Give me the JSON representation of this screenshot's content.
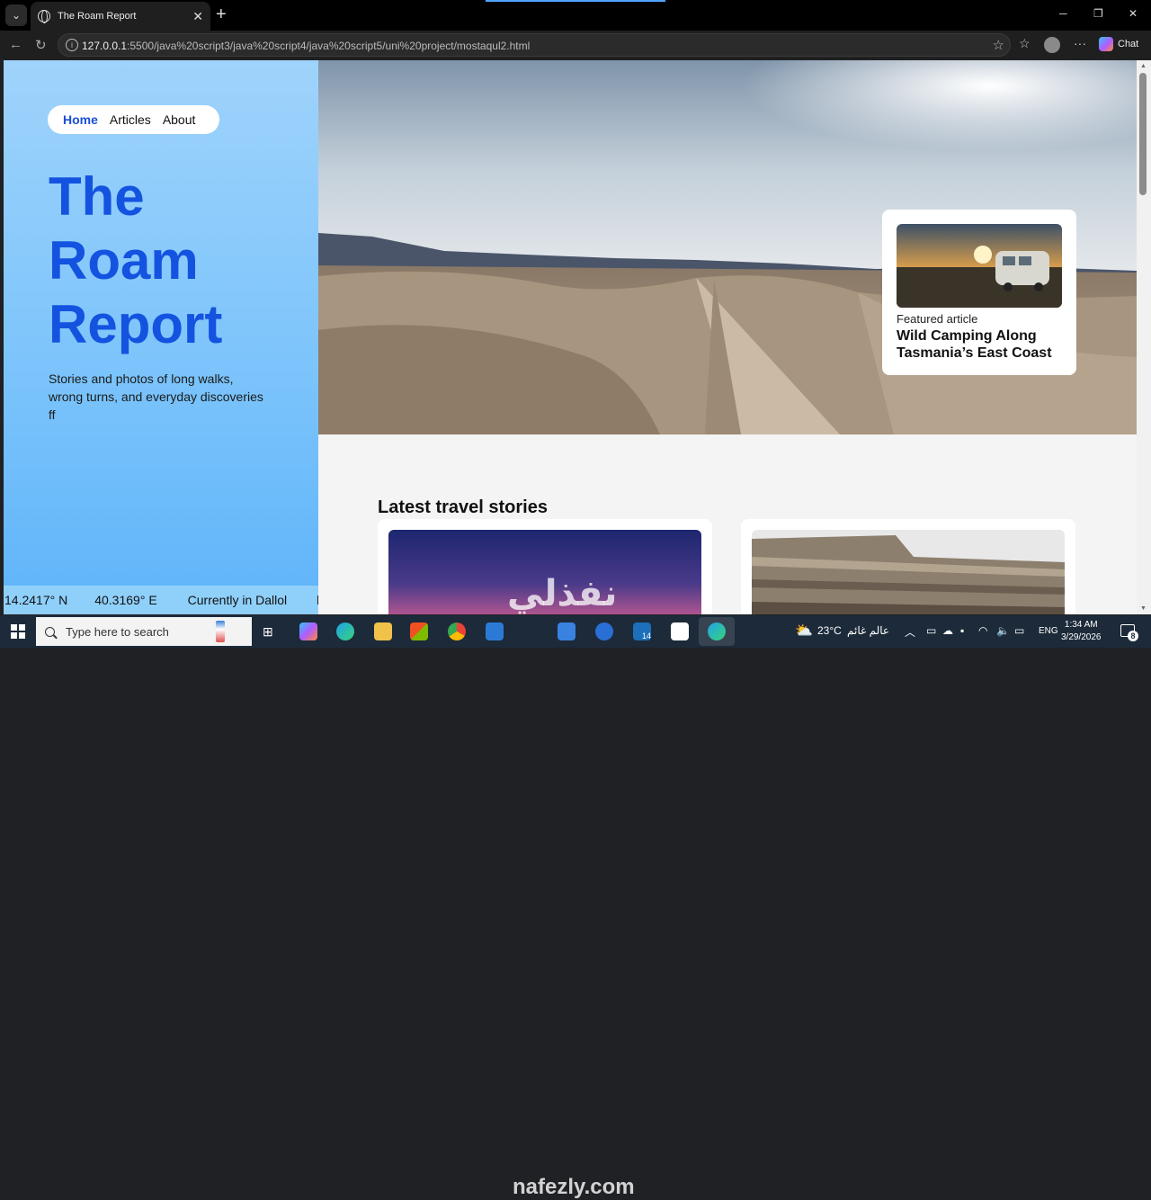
{
  "browser": {
    "tab_title": "The Roam Report",
    "new_tab": "+",
    "close_tab": "✕",
    "url_host": "127.0.0.1",
    "url_rest": ":5500/java%20script3/java%20script4/java%20script5/uni%20project/mostaqul2.html",
    "chat_label": "Chat"
  },
  "site": {
    "nav": {
      "home": "Home",
      "articles": "Articles",
      "about": "About"
    },
    "hero_title_line1": "The",
    "hero_title_line2": "Roam",
    "hero_title_line3": "Report",
    "hero_subtitle": "Stories and photos of long walks, wrong turns, and everyday discoveries ff",
    "ticker": {
      "latitude": "14.2417° N",
      "longitude": "40.3169° E",
      "location": "Currently in Dallol",
      "trailing": "l"
    },
    "featured": {
      "label": "Featured article",
      "title": "Wild Camping Along Tasmania’s East Coast"
    },
    "latest_heading": "Latest travel stories"
  },
  "watermark": {
    "arabic": "نفذلي",
    "latin": "nafezly.com"
  },
  "taskbar": {
    "search_placeholder": "Type here to search",
    "weather": "23°C",
    "weather_text": "عالم غائم",
    "language": "ENG",
    "time": "1:34 AM",
    "date": "3/29/2026",
    "badge_14": "14",
    "notif_count": "8"
  }
}
